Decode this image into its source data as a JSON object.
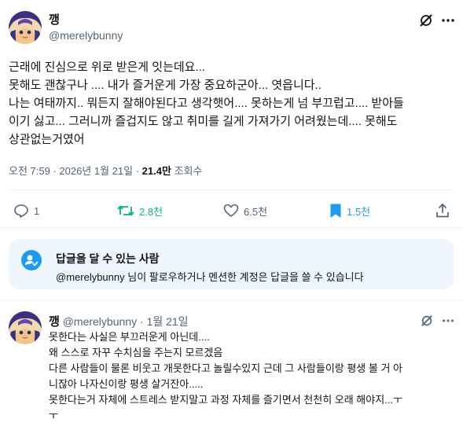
{
  "post": {
    "display_name": "깽",
    "handle": "@merelybunny",
    "body_lines": [
      "근래에 진심으로 위로 받은게 잇는데요...",
      "못해도 괜찮구나 .... 내가 즐거운게 가장 중요하군아... 엿읍니다..",
      "나는 여태까지.. 뭐든지 잘해야된다고 생각햇어.... 못하는게 넘 부끄럽고.... 받아들",
      "이기 싫고... 그러니까 즐겁지도 않고 취미를 길게 가져가기 어려웠는데.... 못해도",
      "상관없는거였어"
    ],
    "timestamp": "오전 7:59 · 2026년 1월 21일 · ",
    "views_count": "21.4만",
    "views_label": " 조회수",
    "stats": {
      "replies": "1",
      "reposts": "2.8천",
      "likes": "6.5천",
      "bookmarks": "1.5천"
    }
  },
  "reply_notice": {
    "title": "답글을 달 수 있는 사람",
    "description": "@merelybunny 님이 팔로우하거나 멘션한 계정은 답글을 쓸 수 있습니다"
  },
  "reply": {
    "display_name": "깽",
    "handle": "@merelybunny",
    "separator": " · ",
    "date": "1월 21일",
    "body_lines": [
      "못한다는 사실은 부끄러운게 아닌데....",
      "왜 스스로 자꾸 수치심을 주는지 모르겠음",
      "다른 사람들이 물론 비웃고 개못한다고 놀릴수있지 근데 그 사람들이랑 평생 볼 거 아",
      "니잖아 나자신이랑 평생 살거잔아.....",
      "못한다는거 자체에 스트레스 받지말고 과정 자체를 즐기면서 천천히 오래 해야지...ㅜ",
      "ㅜ"
    ]
  },
  "icons": {
    "grok": "grok-icon",
    "more": "more-icon",
    "reply": "reply-icon",
    "repost": "repost-icon",
    "like": "heart-icon",
    "bookmark": "bookmark-icon",
    "share": "share-icon",
    "notice": "person-check-icon"
  },
  "colors": {
    "repost_green": "#00ba7c",
    "bookmark_blue": "#1d9bf0",
    "muted": "#536471",
    "notice_bg": "#f0f6fd"
  }
}
